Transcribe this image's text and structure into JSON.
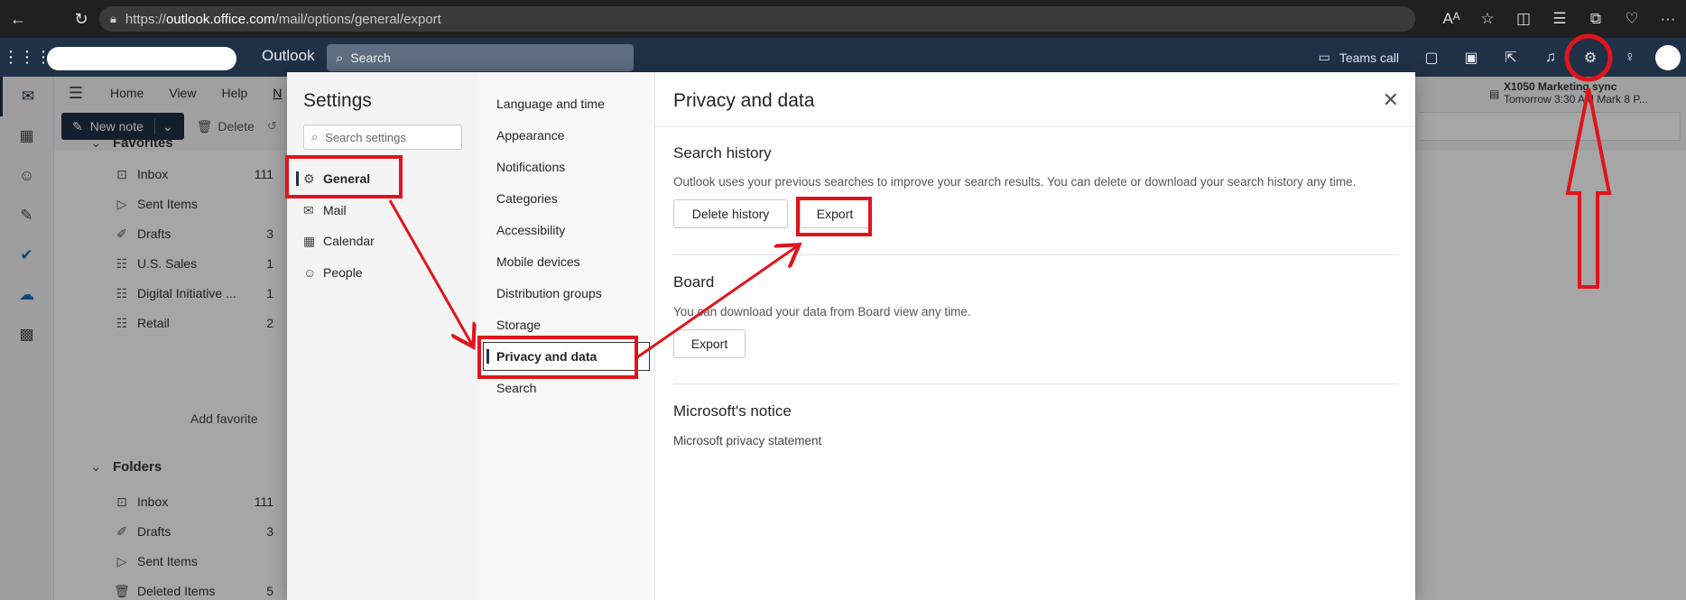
{
  "browser": {
    "url_prefix": "https://",
    "url_host": "outlook.office.com",
    "url_path": "/mail/options/general/export",
    "icons": [
      "back-icon",
      "refresh-icon",
      "lock-icon",
      "read-aloud-icon",
      "favorite-icon",
      "split-screen-icon",
      "favorites-icon",
      "collections-icon",
      "health-icon",
      "more-icon"
    ],
    "read_aloud": "Aᴬ",
    "more": "···"
  },
  "header": {
    "app_name": "Outlook",
    "search_placeholder": "Search",
    "teams_call": "Teams call"
  },
  "ribbon": {
    "tabs": [
      "Home",
      "View",
      "Help",
      "N"
    ],
    "new_note": "New note",
    "delete": "Delete"
  },
  "folders": {
    "favorites_label": "Favorites",
    "favorites": [
      {
        "name": "Inbox",
        "count": "111",
        "icon": "inbox-icon"
      },
      {
        "name": "Sent Items",
        "count": "",
        "icon": "send-icon"
      },
      {
        "name": "Drafts",
        "count": "3",
        "icon": "drafts-icon"
      },
      {
        "name": "U.S. Sales",
        "count": "1",
        "icon": "group-icon"
      },
      {
        "name": "Digital Initiative ...",
        "count": "1",
        "icon": "group-icon"
      },
      {
        "name": "Retail",
        "count": "2",
        "icon": "group-icon"
      }
    ],
    "add_favorite": "Add favorite",
    "folders_label": "Folders",
    "folders": [
      {
        "name": "Inbox",
        "count": "111",
        "icon": "inbox-icon"
      },
      {
        "name": "Drafts",
        "count": "3",
        "icon": "drafts-icon"
      },
      {
        "name": "Sent Items",
        "count": "",
        "icon": "send-icon"
      },
      {
        "name": "Deleted Items",
        "count": "5",
        "icon": "trash-icon"
      }
    ]
  },
  "reminder": {
    "title": "X1050 Marketing sync",
    "detail": "Tomorrow 3:30 AM Mark 8 P..."
  },
  "settings": {
    "title": "Settings",
    "search_placeholder": "Search settings",
    "categories": [
      {
        "label": "General",
        "icon": "gear-icon",
        "selected": true
      },
      {
        "label": "Mail",
        "icon": "mail-icon",
        "selected": false
      },
      {
        "label": "Calendar",
        "icon": "calendar-icon",
        "selected": false
      },
      {
        "label": "People",
        "icon": "people-icon",
        "selected": false
      }
    ],
    "subcategories": [
      {
        "label": "Language and time",
        "selected": false
      },
      {
        "label": "Appearance",
        "selected": false
      },
      {
        "label": "Notifications",
        "selected": false
      },
      {
        "label": "Categories",
        "selected": false
      },
      {
        "label": "Accessibility",
        "selected": false
      },
      {
        "label": "Mobile devices",
        "selected": false
      },
      {
        "label": "Distribution groups",
        "selected": false
      },
      {
        "label": "Storage",
        "selected": false
      },
      {
        "label": "Privacy and data",
        "selected": true
      },
      {
        "label": "Search",
        "selected": false
      }
    ]
  },
  "panel": {
    "title": "Privacy and data",
    "search_history": {
      "heading": "Search history",
      "description": "Outlook uses your previous searches to improve your search results. You can delete or download your search history any time.",
      "delete_button": "Delete history",
      "export_button": "Export"
    },
    "board": {
      "heading": "Board",
      "description": "You can download your data from Board view any time.",
      "export_button": "Export"
    },
    "notice": {
      "heading": "Microsoft's notice",
      "link": "Microsoft privacy statement"
    }
  },
  "annotation_color": "#e0141c"
}
